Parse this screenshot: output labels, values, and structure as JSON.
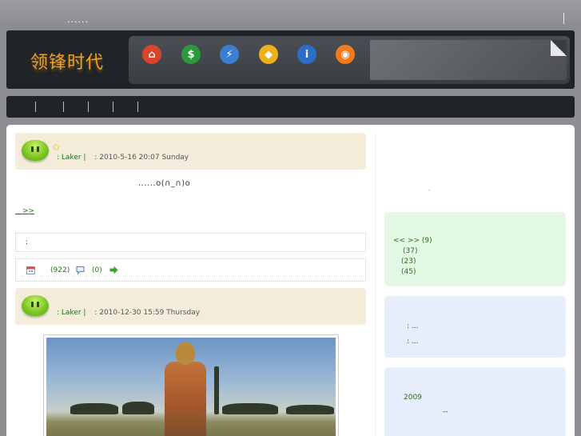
{
  "topbar": {
    "text": "......"
  },
  "header": {
    "logo": "领锋时代"
  },
  "nav_icons": [
    {
      "name": "home-icon",
      "color": "#d9442c",
      "glyph": "⌂"
    },
    {
      "name": "money-icon",
      "color": "#2b9a3a",
      "glyph": "$"
    },
    {
      "name": "usb-icon",
      "color": "#3a7fd0",
      "glyph": "⚡"
    },
    {
      "name": "tag-icon",
      "color": "#f0b21c",
      "glyph": "◆"
    },
    {
      "name": "info-icon",
      "color": "#2a6ec8",
      "glyph": "i"
    },
    {
      "name": "rss-icon",
      "color": "#f07a1c",
      "glyph": "◉"
    }
  ],
  "posts": [
    {
      "author": ": Laker |",
      "date": ": 2010-5-16 20:07 Sunday",
      "body": "......o(∩_∩)o",
      "readmore": "__>>",
      "tags_label": ":",
      "views": "(922)",
      "comments": "(0)"
    },
    {
      "author": ": Laker |",
      "date": ": 2010-12-30 15:59 Thursday"
    }
  ],
  "sidebar": {
    "top_text": ".",
    "green_panel": {
      "lines": [
        "<< >> (9)",
        "(37)",
        "(23)",
        "(45)"
      ]
    },
    "blue_panel": {
      "lines": [
        ":      ...",
        ":      ..."
      ]
    },
    "archive_panel": {
      "year": "2009",
      "sub": "--"
    }
  }
}
